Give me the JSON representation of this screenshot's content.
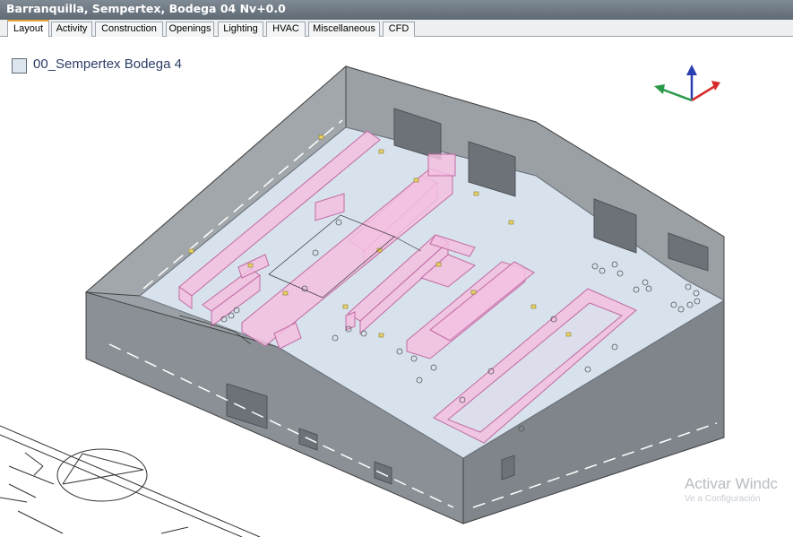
{
  "window": {
    "title": "Barranquilla, Sempertex, Bodega 04 Nv+0.0"
  },
  "tabs": [
    {
      "label": "Layout",
      "active": true
    },
    {
      "label": "Activity"
    },
    {
      "label": "Construction"
    },
    {
      "label": "Openings"
    },
    {
      "label": "Lighting"
    },
    {
      "label": "HVAC"
    },
    {
      "label": "Miscellaneous"
    },
    {
      "label": "CFD"
    }
  ],
  "viewport": {
    "layer": {
      "label": "00_Sempertex Bodega 4"
    },
    "axis_gizmo": {
      "icons": [
        "x-axis-arrow-icon",
        "y-axis-arrow-icon",
        "z-axis-arrow-icon"
      ]
    },
    "watermark": {
      "text": "Activar Windc",
      "subtext": "Ve a Configuración"
    }
  },
  "colors": {
    "title_bar": "#6d7883",
    "active_tab_accent": "#e8a33a",
    "wall": "#8e9499",
    "floor": "#d8e2ec",
    "block_fill": "#f3bfe0",
    "block_stroke": "#c06aa4",
    "light_fixture": "#e8d36a",
    "axis_x": "#d62a2a",
    "axis_y": "#2a9a4a",
    "axis_z": "#2a3fb0"
  }
}
